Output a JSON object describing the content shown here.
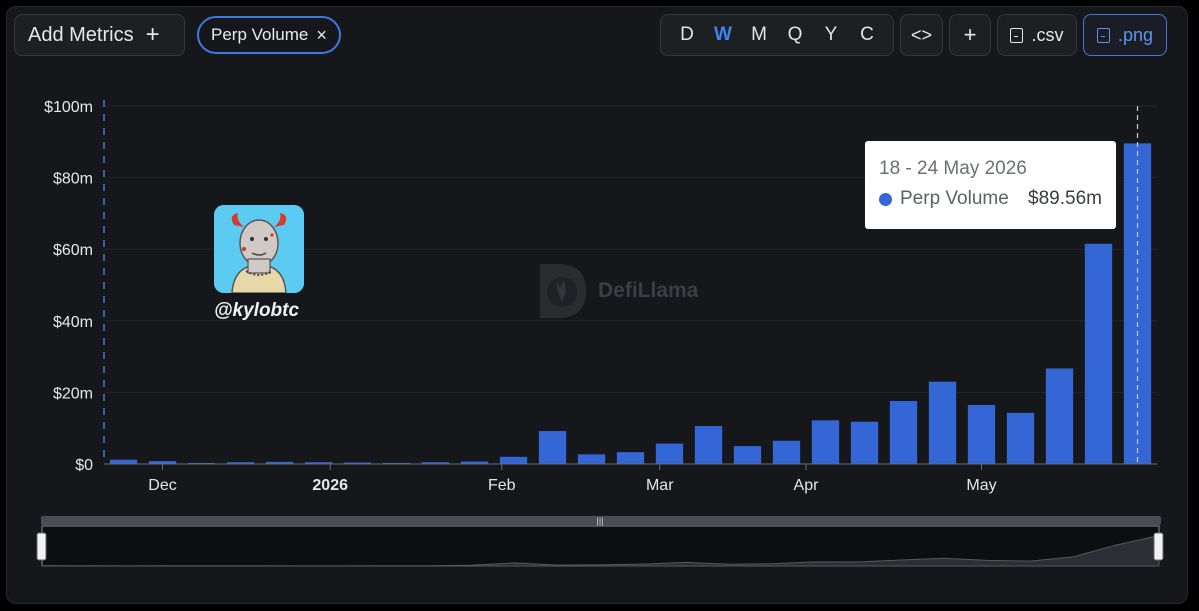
{
  "toolbar": {
    "add_metrics_label": "Add Metrics",
    "add_metrics_plus": "+",
    "active_metric_chip": "Perp Volume",
    "chip_close": "×",
    "periods": [
      "D",
      "W",
      "M",
      "Q",
      "Y",
      "C"
    ],
    "active_period": "W",
    "embed_label": "<>",
    "add_label": "+",
    "csv_label": ".csv",
    "png_label": ".png"
  },
  "watermark": {
    "name": "DefiLlama"
  },
  "overlay": {
    "handle": "@kylobtc"
  },
  "tooltip": {
    "date": "18 - 24 May 2026",
    "series": "Perp Volume",
    "value": "$89.56m"
  },
  "colors": {
    "bar": "#3566d6",
    "accent": "#3c79e0",
    "background": "#16171a"
  },
  "chart_data": {
    "type": "bar",
    "title": "",
    "xlabel": "",
    "ylabel": "",
    "ylim": [
      0,
      100
    ],
    "y_unit": "$m",
    "y_ticks": [
      "$0",
      "$20m",
      "$40m",
      "$60m",
      "$80m",
      "$100m"
    ],
    "y_tick_values": [
      0,
      20,
      40,
      60,
      80,
      100
    ],
    "x_tick_labels": [
      "Dec",
      "2026",
      "Feb",
      "Mar",
      "Apr",
      "May"
    ],
    "x_tick_bold": [
      false,
      true,
      false,
      false,
      false,
      false
    ],
    "x_tick_bar_index": [
      1.5,
      5.8,
      10.2,
      14.25,
      18.0,
      22.5
    ],
    "highlight_index": 26,
    "grid": true,
    "series": [
      {
        "name": "Perp Volume",
        "values": [
          1.2,
          0.8,
          0.3,
          0.5,
          0.6,
          0.5,
          0.4,
          0.3,
          0.5,
          0.7,
          2.0,
          9.2,
          2.7,
          3.3,
          5.7,
          10.6,
          5.0,
          6.5,
          12.2,
          11.8,
          17.6,
          23.0,
          16.5,
          14.3,
          26.7,
          61.5,
          89.56
        ]
      }
    ]
  }
}
